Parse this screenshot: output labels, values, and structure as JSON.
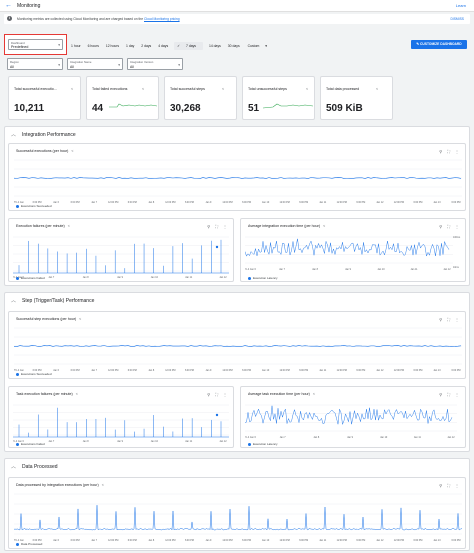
{
  "header": {
    "title": "Monitoring",
    "learn": "Learn"
  },
  "info": {
    "text": "Monitoring metrics are collected using Cloud Monitoring and are charged based on the",
    "link": "Cloud Monitoring pricing",
    "dismiss": "DISMISS"
  },
  "dashboard_select": {
    "label": "Dashboard",
    "value": "Predefined"
  },
  "time_ranges": [
    "1 hour",
    "6 hours",
    "12 hours",
    "1 day",
    "2 days",
    "4 days",
    "7 days",
    "14 days",
    "30 days",
    "Custom"
  ],
  "selected_time_range": "7 days",
  "customize_button": "CUSTOMIZE DASHBOARD",
  "filters": [
    {
      "label": "Region",
      "value": "All"
    },
    {
      "label": "Integration Name",
      "value": "All"
    },
    {
      "label": "Integration Version",
      "value": "All"
    }
  ],
  "stat_cards": [
    {
      "title": "Total successful executio...",
      "value": "10,211",
      "sparkline": false
    },
    {
      "title": "Total failed executions",
      "value": "44",
      "sparkline": true
    },
    {
      "title": "Total successful steps",
      "value": "30,268",
      "sparkline": false
    },
    {
      "title": "Total unsuccessful steps",
      "value": "51",
      "sparkline": true
    },
    {
      "title": "Total data processed",
      "value": "509 KiB",
      "sparkline": false
    }
  ],
  "sections": {
    "integration": "Integration Performance",
    "step": "Step (Trigger/Task) Performance",
    "data": "Data Processed"
  },
  "charts": {
    "successful_executions": {
      "title": "Successful executions (per hour)",
      "legend": "Executions Succeeded"
    },
    "execution_failures": {
      "title": "Execution failures (per minute)",
      "legend": "Executions Failed"
    },
    "avg_exec_time": {
      "title": "Average integration execution time (per hour)",
      "legend": "Execution Latency",
      "y_top": "100ms",
      "y_bottom": "10ms"
    },
    "successful_steps": {
      "title": "Successful step executions (per hour)",
      "legend": "Executions Succeeded"
    },
    "task_failures": {
      "title": "Task execution failures (per minute)",
      "legend": "Executions Failed"
    },
    "avg_task_time": {
      "title": "Average task execution time (per hour)",
      "legend": "Execution Latency"
    },
    "data_processed": {
      "title": "Data processed by integration executions (per hour)",
      "legend": "Data Processed"
    }
  },
  "x_ticks_wide": [
    "UTC-4 Jan",
    "6:00 PM",
    "Jan 6",
    "6:00 PM",
    "Jan 7",
    "12:00 PM",
    "6:00 PM",
    "Jan 8",
    "12:00 PM",
    "6:00 PM",
    "Jan 9",
    "12:00 PM",
    "6:00 PM",
    "Jan 10",
    "12:00 PM",
    "6:00 PM",
    "Jan 11",
    "12:00 PM",
    "6:00 PM",
    "Jan 12",
    "12:00 PM",
    "6:00 PM",
    "Jan 13",
    "6:00 PM"
  ],
  "x_ticks_narrow": [
    "UTC-4 Jan 6",
    "Jan 7",
    "Jan 8",
    "Jan 9",
    "Jan 10",
    "Jan 11",
    "Jan 12"
  ],
  "colors": {
    "accent": "#1a73e8",
    "highlight_border": "#e53935",
    "page_bg": "#f1f3f4"
  },
  "icons": [
    "back-arrow-icon",
    "info-icon",
    "share-icon",
    "zoom-icon",
    "fullscreen-icon",
    "more-vert-icon",
    "chevron-up-icon",
    "dropdown-caret-icon",
    "edit-icon",
    "check-icon"
  ]
}
